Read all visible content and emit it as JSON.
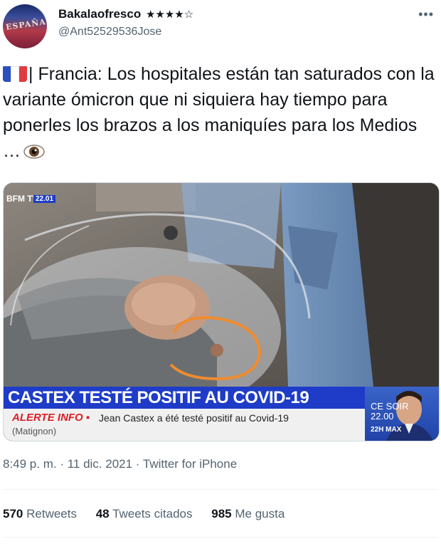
{
  "author": {
    "display_name": "Bakalaofresco",
    "badge": "★★★★☆",
    "handle": "@Ant52529536Jose",
    "avatar_text": "ESPAÑA"
  },
  "menu_icon": "more-horizontal-icon",
  "tweet": {
    "flag": "france-flag-icon",
    "text_after_flag": "| Francia: Los hospitales están tan saturados con la variante ómicron que ni siquiera hay tiempo para ponerles los brazos a los maniquíes para los Medios …",
    "trailing_emoji": "eye-icon"
  },
  "media": {
    "channel_logo": "BFM TV.",
    "time": "22.01",
    "headline": "CASTEX TESTÉ POSITIF AU COVID-19",
    "alert_label": "ALERTE INFO ▪",
    "alert_message": "Jean Castex a été testé positif au Covid-19",
    "source": "(Matignon)",
    "promo_line1": "CE SOIR",
    "promo_line2": "22.00",
    "promo_line3": "22H MAX"
  },
  "meta": {
    "timestamp": "8:49 p. m. · 11 dic. 2021 · Twitter for iPhone"
  },
  "stats": [
    {
      "count": "570",
      "label": "Retweets"
    },
    {
      "count": "48",
      "label": "Tweets citados"
    },
    {
      "count": "985",
      "label": "Me gusta"
    }
  ],
  "colors": {
    "text": "#0f1419",
    "secondary": "#536471",
    "ticker_blue": "#1e3cc8",
    "alert_red": "#d91f26",
    "highlight_circle": "#f08c2e"
  }
}
